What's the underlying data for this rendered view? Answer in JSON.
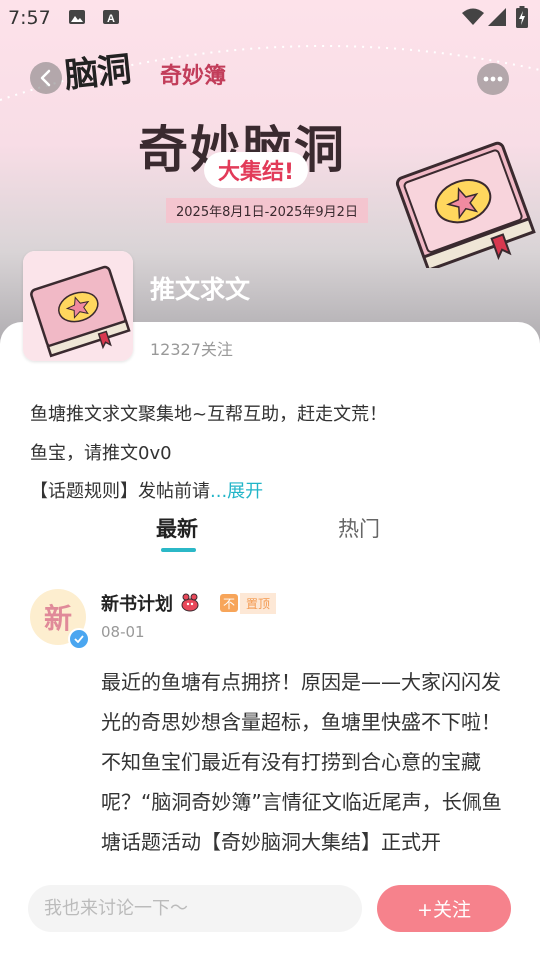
{
  "status_bar": {
    "time": "7:57"
  },
  "banner": {
    "logo_text": "脑洞",
    "logo_sub": "奇妙簿",
    "title": "奇妙脑洞",
    "subtitle": "大集结!",
    "date_range": "2025年8月1日-2025年9月2日"
  },
  "topic": {
    "name": "推文求文",
    "followers": "12327关注",
    "desc_line1": "鱼塘推文求文聚集地~互帮互助，赶走文荒！",
    "desc_line2": "鱼宝，请推文0v0",
    "desc_line3": "【话题规则】发帖前请",
    "expand_label": "...展开"
  },
  "tabs": [
    {
      "label": "最新",
      "active": true
    },
    {
      "label": "热门",
      "active": false
    }
  ],
  "post": {
    "avatar_char": "新",
    "author": "新书计划",
    "pin_icon": "不",
    "pin_label": "置顶",
    "date": "08-01",
    "body": "最近的鱼塘有点拥挤！原因是——大家闪闪发光的奇思妙想含量超标，鱼塘里快盛不下啦！不知鱼宝们最近有没有打捞到合心意的宝藏呢？“脑洞奇妙簿”言情征文临近尾声，长佩鱼塘话题活动【奇妙脑洞大集结】正式开"
  },
  "bottom": {
    "input_placeholder": "我也来讨论一下～",
    "follow_label": "+关注"
  },
  "colors": {
    "accent": "#2bb8c7",
    "follow": "#f6828c",
    "banner_top": "#fde2ea"
  }
}
